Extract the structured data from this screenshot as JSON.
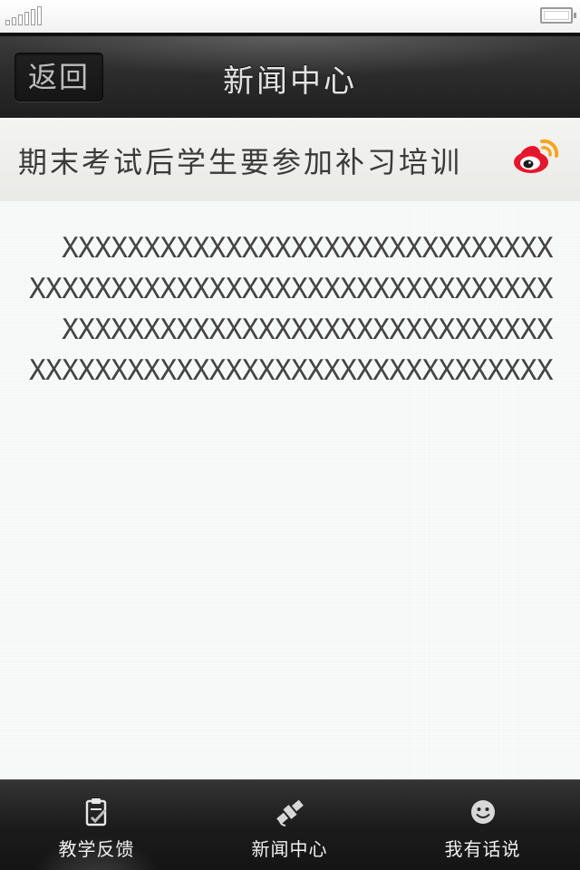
{
  "nav": {
    "back_label": "返回",
    "title": "新闻中心"
  },
  "article": {
    "title": "期末考试后学生要参加补习培训",
    "share_icon": "weibo-icon",
    "body_lines": [
      "XXXXXXXXXXXXXXXXXXXXXXXXXXXXXX",
      "XXXXXXXXXXXXXXXXXXXXXXXXXXXXXXXX",
      "XXXXXXXXXXXXXXXXXXXXXXXXXXXXXX",
      "XXXXXXXXXXXXXXXXXXXXXXXXXXXXXXXX"
    ]
  },
  "tabs": [
    {
      "label": "教学反馈",
      "icon": "clipboard-check-icon"
    },
    {
      "label": "新闻中心",
      "icon": "satellite-icon"
    },
    {
      "label": "我有话说",
      "icon": "smiley-icon"
    }
  ],
  "colors": {
    "nav_background": "#2c2c2c",
    "tab_background": "#1c1c1c",
    "page_background": "#f9fafa",
    "weibo_red": "#e6162d",
    "weibo_orange": "#f5a623"
  }
}
